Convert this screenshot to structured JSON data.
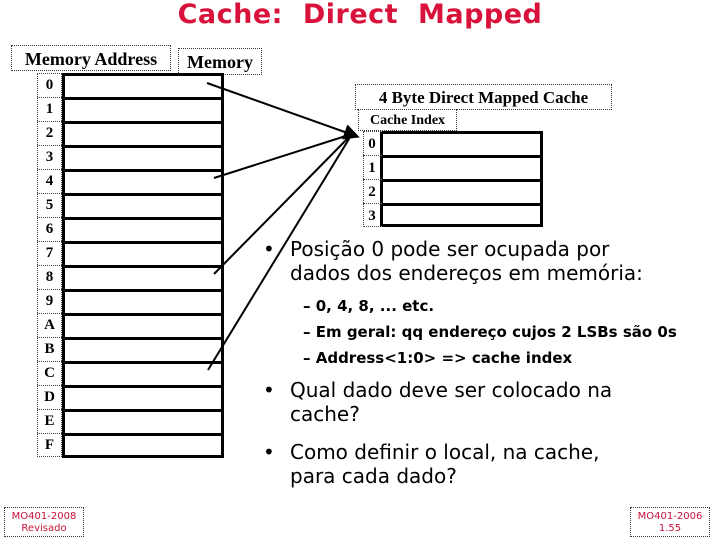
{
  "title": "Cache: Direct  Mapped",
  "memory": {
    "address_header": "Memory Address",
    "memory_header": "Memory",
    "addresses": [
      "0",
      "1",
      "2",
      "3",
      "4",
      "5",
      "6",
      "7",
      "8",
      "9",
      "A",
      "B",
      "C",
      "D",
      "E",
      "F"
    ]
  },
  "cache": {
    "title": "4  Byte Direct Mapped Cache",
    "index_header": "Cache Index",
    "indices": [
      "0",
      "1",
      "2",
      "3"
    ]
  },
  "mappings": [
    {
      "from_address": "0",
      "to_index": "0"
    },
    {
      "from_address": "4",
      "to_index": "0"
    },
    {
      "from_address": "8",
      "to_index": "0"
    },
    {
      "from_address": "C",
      "to_index": "0"
    }
  ],
  "bullets": [
    {
      "lines": [
        "Posição 0 pode ser ocupada por",
        "dados dos endereços em memória:"
      ],
      "sub": [
        "–  0, 4, 8, ... etc.",
        "–  Em geral: qq endereço cujos 2 LSBs são 0s",
        "–  Address<1:0>  => cache index"
      ]
    },
    {
      "lines": [
        "Qual dado deve ser colocado na",
        "cache?"
      ]
    },
    {
      "lines": [
        "Como definir o local, na cache,",
        "para cada dado?"
      ]
    }
  ],
  "footer_left": [
    "MO401-2008",
    "Revisado"
  ],
  "footer_right": [
    "MO401-2006",
    "1.55"
  ]
}
